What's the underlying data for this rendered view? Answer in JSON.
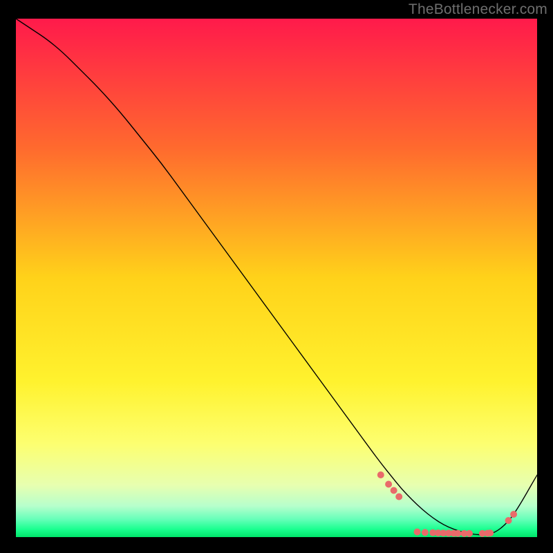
{
  "watermark": "TheBottlenecker.com",
  "chart_data": {
    "type": "line",
    "title": "",
    "xlabel": "",
    "ylabel": "",
    "xlim": [
      0,
      100
    ],
    "ylim": [
      0,
      100
    ],
    "background_gradient": {
      "stops": [
        {
          "offset": 0.0,
          "color": "#ff1a4b"
        },
        {
          "offset": 0.25,
          "color": "#ff6a2e"
        },
        {
          "offset": 0.5,
          "color": "#ffd21a"
        },
        {
          "offset": 0.7,
          "color": "#fff22e"
        },
        {
          "offset": 0.82,
          "color": "#fdff70"
        },
        {
          "offset": 0.9,
          "color": "#e7ffb0"
        },
        {
          "offset": 0.94,
          "color": "#b7ffcc"
        },
        {
          "offset": 0.965,
          "color": "#68ffba"
        },
        {
          "offset": 0.985,
          "color": "#1aff8f"
        },
        {
          "offset": 1.0,
          "color": "#00e56a"
        }
      ]
    },
    "series": [
      {
        "name": "bottleneck-curve",
        "color": "#000000",
        "stroke_width": 1.4,
        "x": [
          0,
          3,
          6,
          9,
          12,
          16,
          20,
          24,
          28,
          32,
          36,
          40,
          44,
          48,
          52,
          56,
          60,
          64,
          68,
          70,
          72,
          74,
          76,
          78,
          80,
          82,
          84,
          86,
          88,
          90,
          92,
          94,
          96,
          100
        ],
        "y": [
          100,
          98,
          96,
          93.5,
          90.5,
          86.5,
          82,
          77,
          72,
          66.5,
          61,
          55.5,
          50,
          44.5,
          39,
          33.5,
          28,
          22.5,
          17,
          14.3,
          11.8,
          9.3,
          7.2,
          5.3,
          3.7,
          2.4,
          1.5,
          0.9,
          0.5,
          0.4,
          0.9,
          2.5,
          5,
          12
        ]
      }
    ],
    "dot_series": {
      "name": "highlight-dots",
      "color": "#e96a6a",
      "radius": 5.0,
      "x": [
        70.0,
        71.5,
        72.5,
        73.5,
        77.0,
        78.5,
        80.0,
        81.0,
        82.0,
        83.0,
        84.0,
        84.8,
        86.0,
        87.0,
        89.5,
        90.5,
        91.0,
        94.5,
        95.5
      ],
      "y": [
        12.0,
        10.2,
        9.0,
        7.8,
        1.0,
        0.9,
        0.85,
        0.8,
        0.78,
        0.76,
        0.74,
        0.72,
        0.7,
        0.7,
        0.7,
        0.74,
        0.78,
        3.2,
        4.4
      ]
    }
  }
}
